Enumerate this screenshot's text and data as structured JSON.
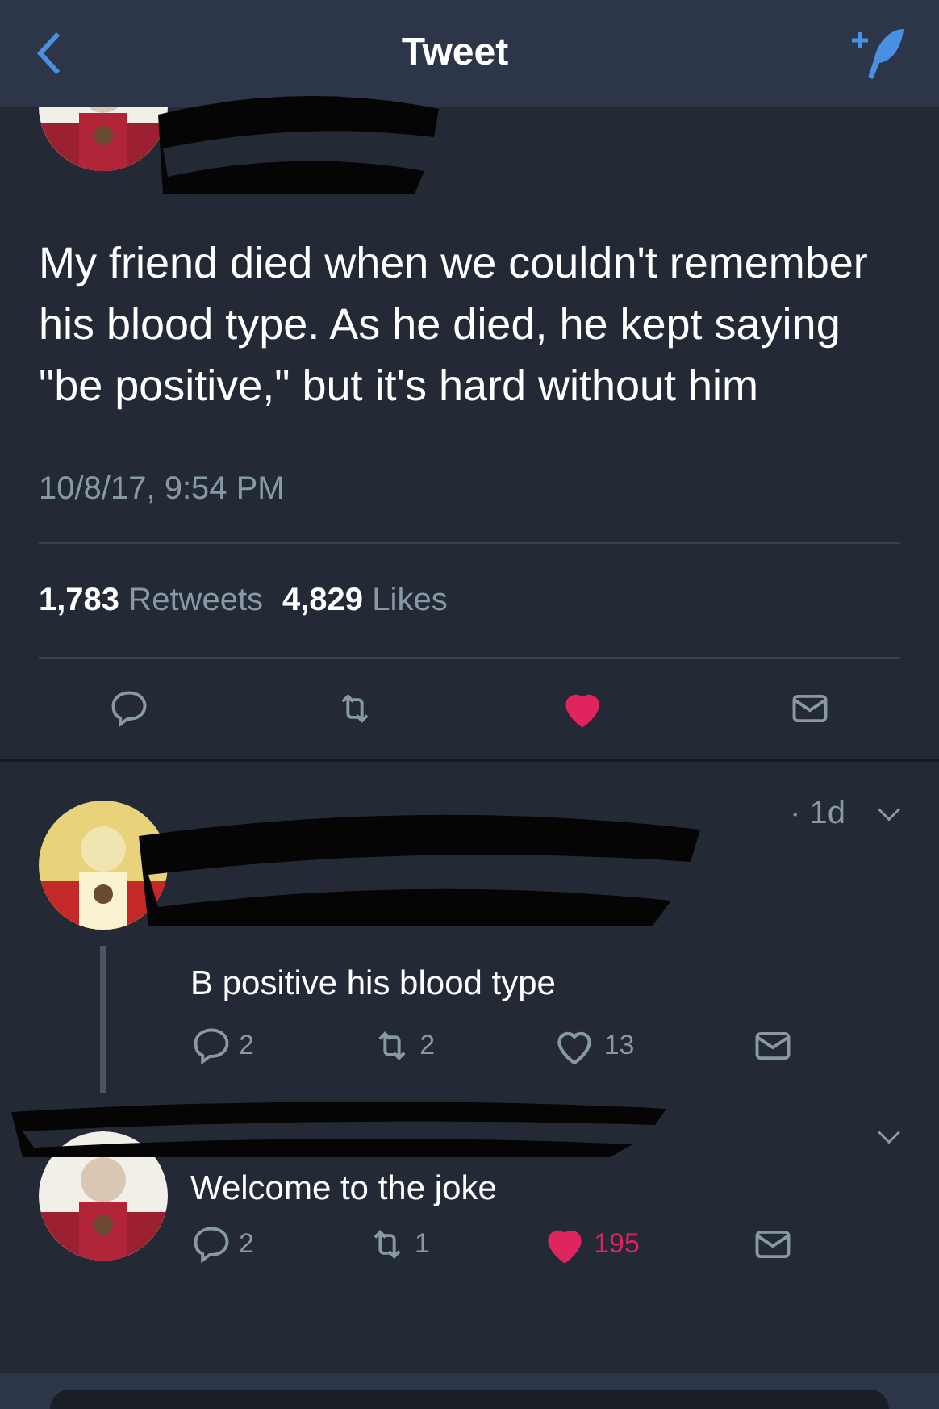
{
  "header": {
    "title": "Tweet"
  },
  "tweet": {
    "text": "My friend died when we couldn't remember his blood type. As he died, he kept saying \"be positive,\" but it's hard without him",
    "timestamp": "10/8/17, 9:54 PM",
    "retweets": "1,783",
    "retweets_label": "Retweets",
    "likes": "4,829",
    "likes_label": "Likes",
    "liked": true
  },
  "replies": [
    {
      "time": "· 1d",
      "text": "B positive his blood type",
      "replies": "2",
      "retweets": "2",
      "likes": "13",
      "liked": false
    },
    {
      "text": "Welcome to the joke",
      "replies": "2",
      "retweets": "1",
      "likes": "195",
      "liked": true
    }
  ]
}
